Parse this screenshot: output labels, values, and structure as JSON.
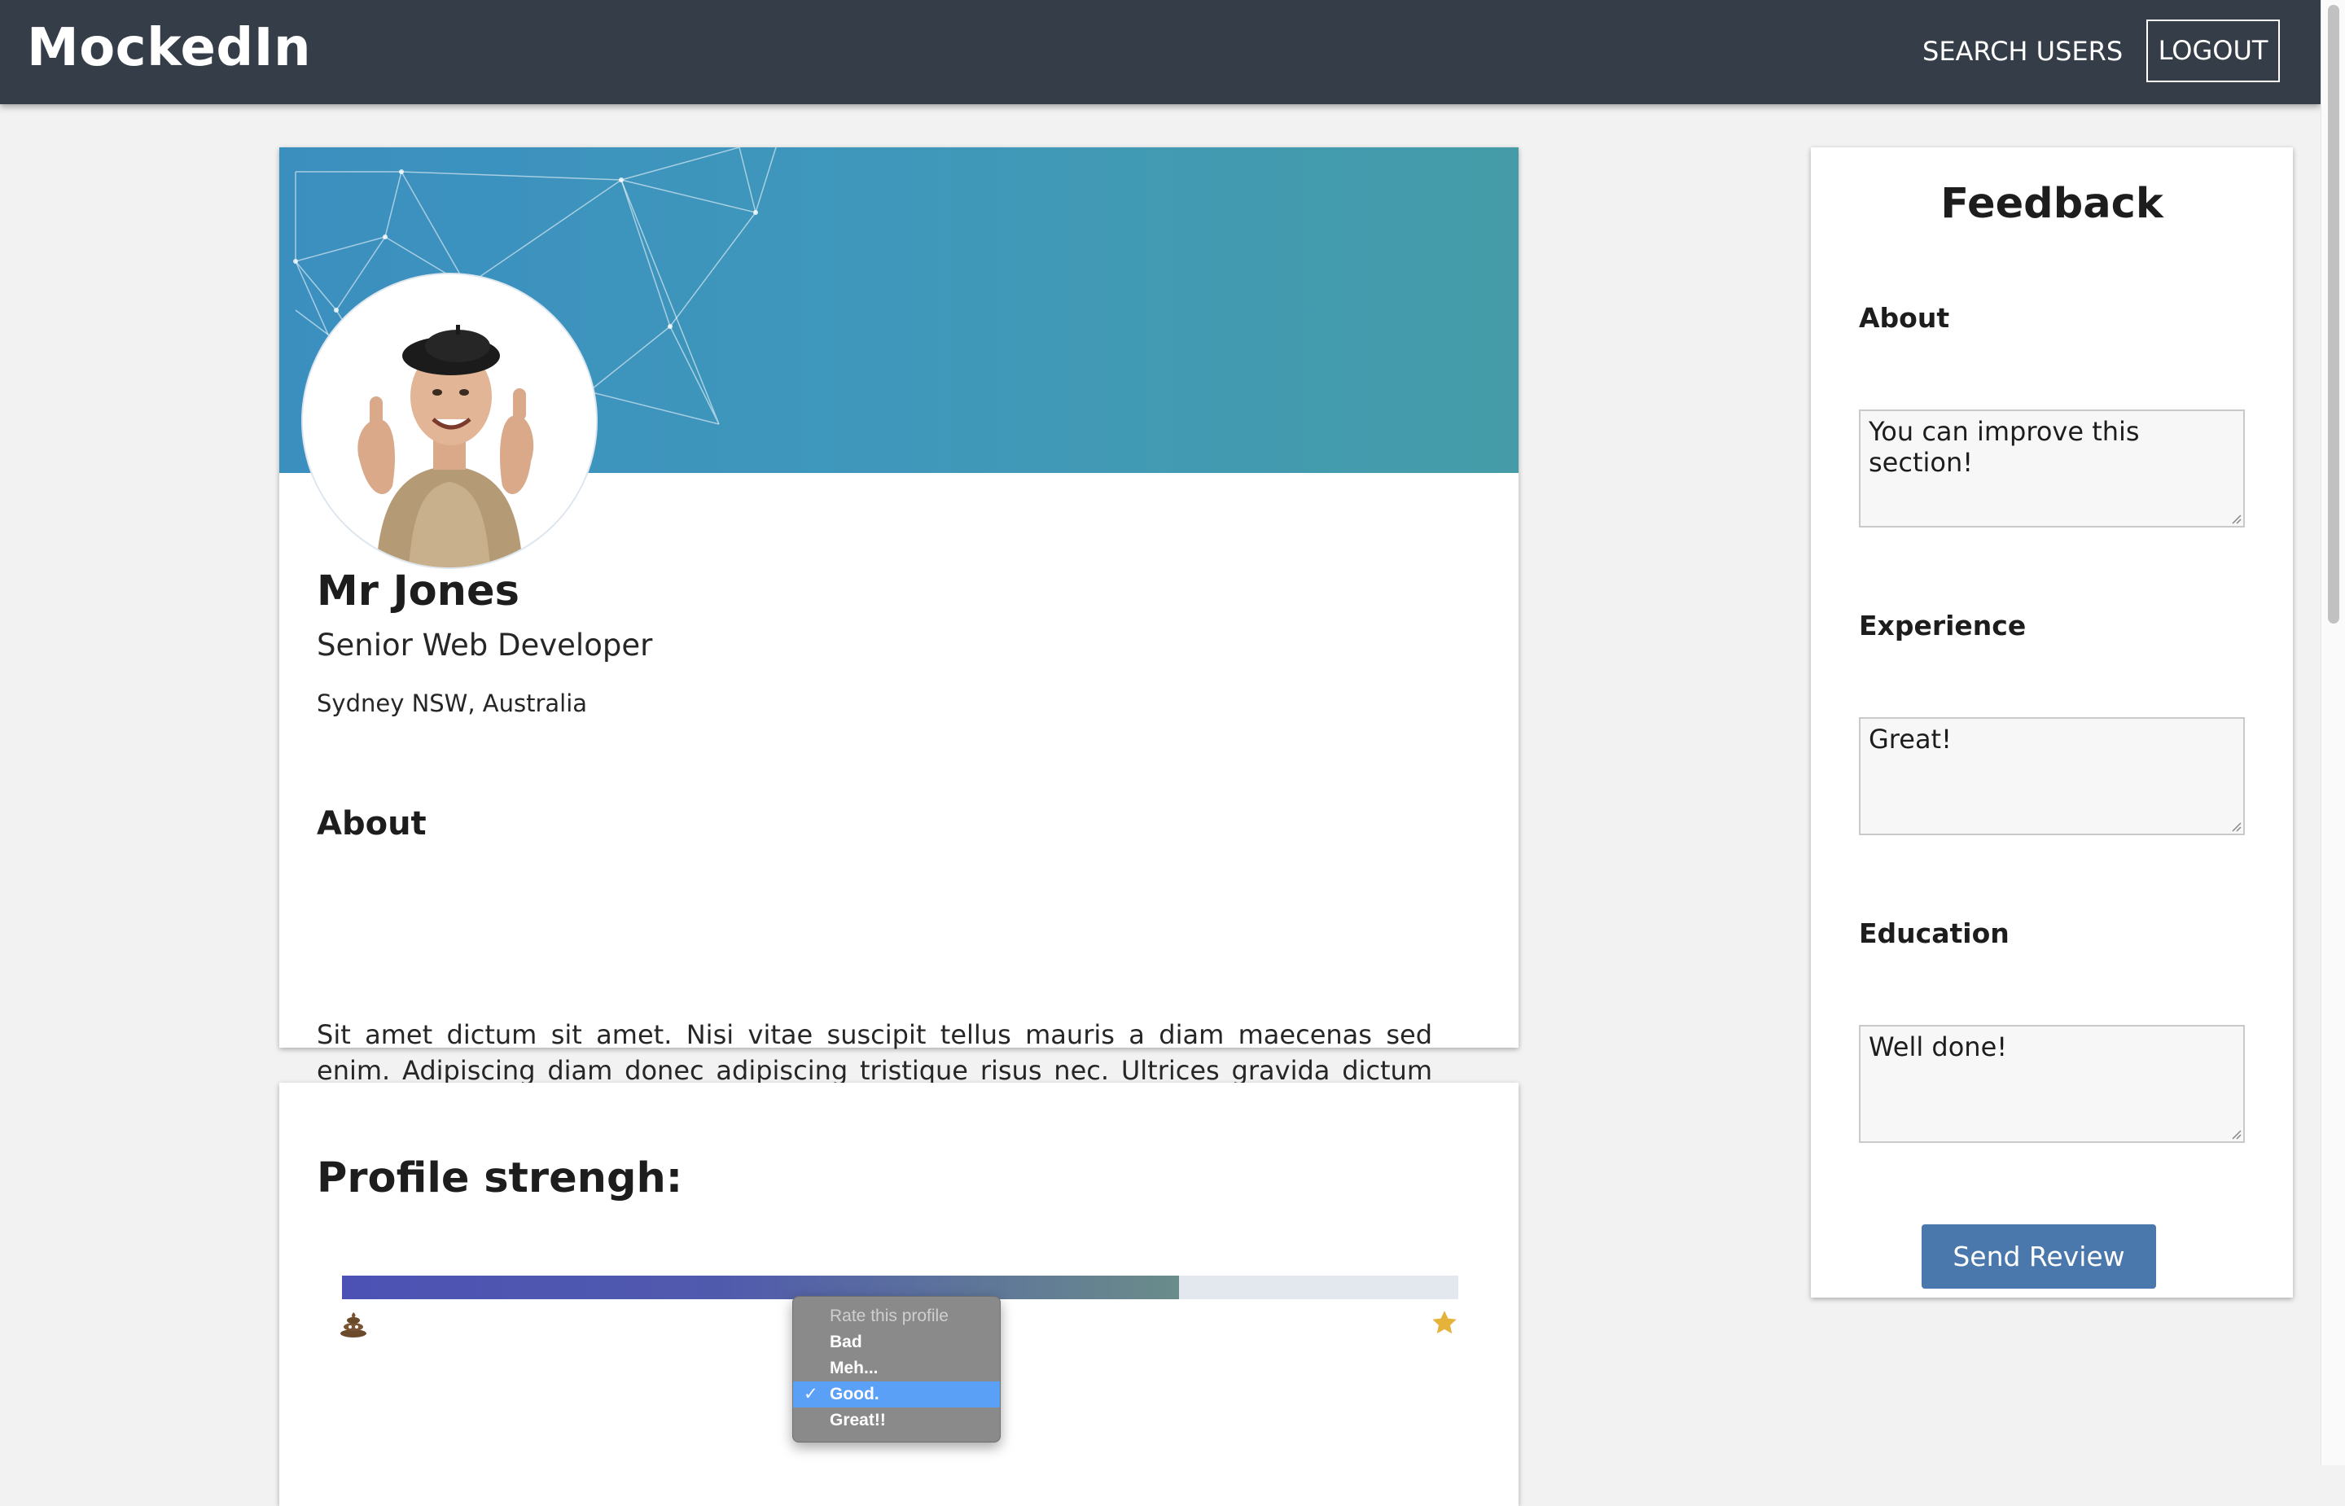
{
  "nav": {
    "brand": "MockedIn",
    "search_label": "SEARCH USERS",
    "logout_label": "LOGOUT",
    "bg_color": "#353e48"
  },
  "profile": {
    "name": "Mr Jones",
    "title": "Senior Web Developer",
    "location": "Sydney NSW, Australia",
    "about_heading": "About",
    "about_text": "Sit amet dictum sit amet. Nisi vitae suscipit tellus mauris a diam maecenas sed enim. Adipiscing diam donec adipiscing tristique risus nec. Ultrices gravida dictum fusce ut placerat orci nulla.",
    "banner_color": "#3f98bb"
  },
  "strength": {
    "heading": "Profile strengh:",
    "value_fraction": 0.75,
    "low_icon": "poop-icon",
    "high_icon": "star-icon"
  },
  "rating_dropdown": {
    "placeholder": "Rate this profile",
    "options": [
      "Bad",
      "Meh...",
      "Good.",
      "Great!!"
    ],
    "selected": "Good."
  },
  "feedback": {
    "title": "Feedback",
    "sections": [
      {
        "label": "About",
        "value": "You can improve this section!"
      },
      {
        "label": "Experience",
        "value": "Great!"
      },
      {
        "label": "Education",
        "value": "Well done!"
      }
    ],
    "send_label": "Send Review",
    "send_color": "#4a78ad"
  }
}
